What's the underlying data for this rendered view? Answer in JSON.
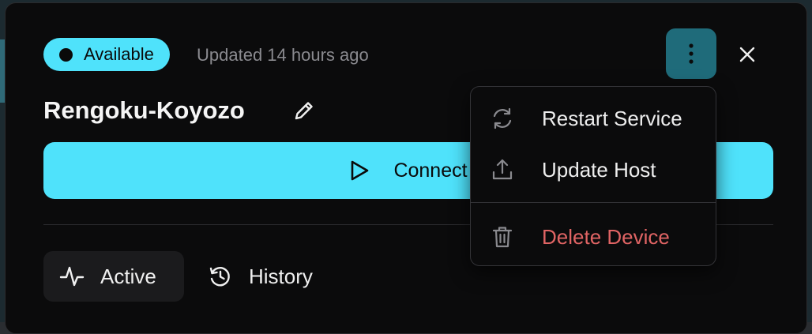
{
  "status": {
    "label": "Available",
    "updated_text": "Updated 14 hours ago"
  },
  "device": {
    "name": "Rengoku-Koyozo"
  },
  "connect": {
    "label": "Connect"
  },
  "tabs": [
    {
      "label": "Active",
      "icon": "activity-icon",
      "selected": true
    },
    {
      "label": "History",
      "icon": "history-icon",
      "selected": false
    }
  ],
  "menu": {
    "items": [
      {
        "label": "Restart Service",
        "icon": "refresh-icon"
      },
      {
        "label": "Update Host",
        "icon": "upload-icon"
      },
      {
        "label": "Delete Device",
        "icon": "trash-icon"
      }
    ]
  },
  "colors": {
    "accent": "#4fe2fb",
    "more_button_bg": "#1f6b7a",
    "danger": "#e06464",
    "panel_bg": "#0b0b0c"
  }
}
